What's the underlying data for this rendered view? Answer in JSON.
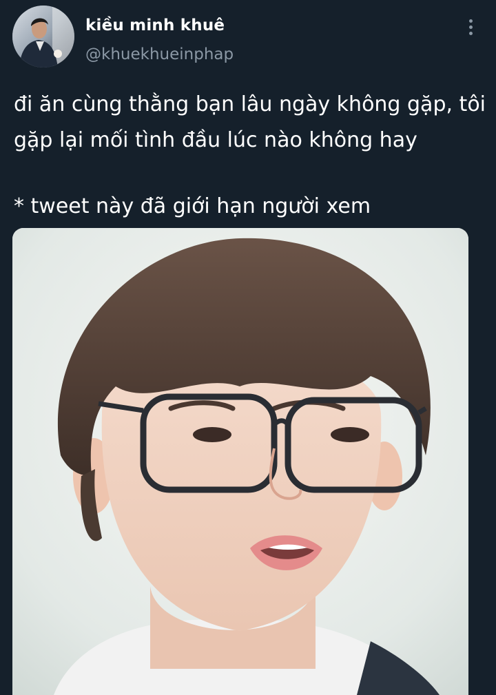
{
  "user": {
    "display_name": "kiều minh khuê",
    "handle": "@khuekhueinphap"
  },
  "tweet": {
    "lines": [
      "đi ăn cùng thằng bạn lâu ngày không gặp, tôi",
      "gặp lại mối tình đầu lúc nào không hay"
    ],
    "note": "* tweet này đã giới hạn người xem"
  },
  "icons": {
    "more": "more-vertical-icon"
  },
  "colors": {
    "background": "#15202b",
    "primary_text": "#ffffff",
    "secondary_text": "#8b98a5"
  }
}
